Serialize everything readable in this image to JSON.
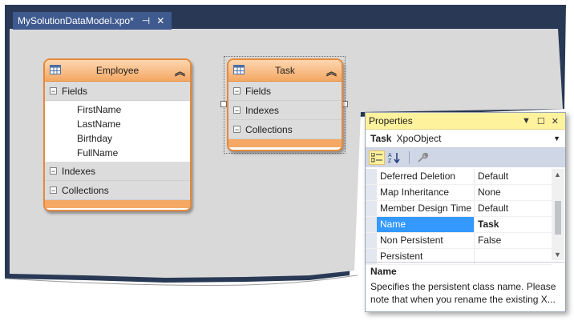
{
  "tab": {
    "title": "MySolutionDataModel.xpo*",
    "pin_glyph": "⊣",
    "close_glyph": "✕"
  },
  "employee": {
    "name": "Employee",
    "sections": {
      "fields": "Fields",
      "indexes": "Indexes",
      "collections": "Collections"
    },
    "fields": [
      "FirstName",
      "LastName",
      "Birthday",
      "FullName"
    ]
  },
  "task": {
    "name": "Task",
    "sections": {
      "fields": "Fields",
      "indexes": "Indexes",
      "collections": "Collections"
    }
  },
  "properties": {
    "title": "Properties",
    "object_name": "Task",
    "object_type": "XpoObject",
    "rows": [
      {
        "key": "Deferred Deletion",
        "value": "Default"
      },
      {
        "key": "Map Inheritance",
        "value": "None"
      },
      {
        "key": "Member Design Time",
        "value": "Default"
      },
      {
        "key": "Name",
        "value": "Task"
      },
      {
        "key": "Non Persistent",
        "value": "False"
      },
      {
        "key": "Persistent",
        "value": ""
      }
    ],
    "selected_row": "Name",
    "description_title": "Name",
    "description_text": "Specifies the persistent class name. Please note that when you rename the existing X..."
  },
  "colors": {
    "accent_tab": "#3f5a8f",
    "shape_border": "#e68a3a",
    "shape_header": "#f4a864",
    "props_title": "#fff29d",
    "selection": "#3399ff"
  }
}
